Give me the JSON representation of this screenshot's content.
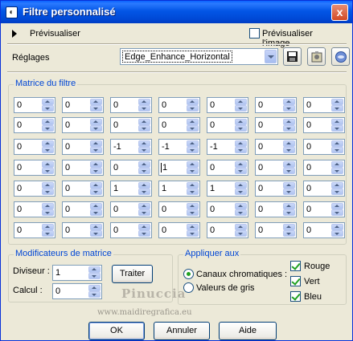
{
  "window": {
    "title": "Filtre personnalisé",
    "close_glyph": "x"
  },
  "preview": {
    "label": "Prévisualiser",
    "image_label": "Prévisualiser l'image",
    "image_checked": false
  },
  "settings": {
    "label": "Réglages",
    "preset": "Edge_Enhance_Horizontal"
  },
  "matrix": {
    "legend": "Matrice du filtre",
    "rows": [
      [
        "0",
        "0",
        "0",
        "0",
        "0",
        "0",
        "0"
      ],
      [
        "0",
        "0",
        "0",
        "0",
        "0",
        "0",
        "0"
      ],
      [
        "0",
        "0",
        "-1",
        "-1",
        "-1",
        "0",
        "0"
      ],
      [
        "0",
        "0",
        "0",
        "1",
        "0",
        "0",
        "0"
      ],
      [
        "0",
        "0",
        "1",
        "1",
        "1",
        "0",
        "0"
      ],
      [
        "0",
        "0",
        "0",
        "0",
        "0",
        "0",
        "0"
      ],
      [
        "0",
        "0",
        "0",
        "0",
        "0",
        "0",
        "0"
      ]
    ]
  },
  "modifiers": {
    "legend": "Modificateurs de matrice",
    "divisor_label": "Diviseur :",
    "divisor_value": "1",
    "bias_label": "Calcul :",
    "bias_value": "0",
    "process_button": "Traiter"
  },
  "apply": {
    "legend": "Appliquer aux",
    "color_channels_label": "Canaux chromatiques :",
    "grayscale_label": "Valeurs de gris",
    "selected": "color_channels",
    "red_label": "Rouge",
    "green_label": "Vert",
    "blue_label": "Bleu",
    "red_checked": true,
    "green_checked": true,
    "blue_checked": true
  },
  "watermark": {
    "name": "Pinuccia",
    "url": "www.maidiregrafica.eu"
  },
  "buttons": {
    "ok": "OK",
    "cancel": "Annuler",
    "help": "Aide"
  }
}
